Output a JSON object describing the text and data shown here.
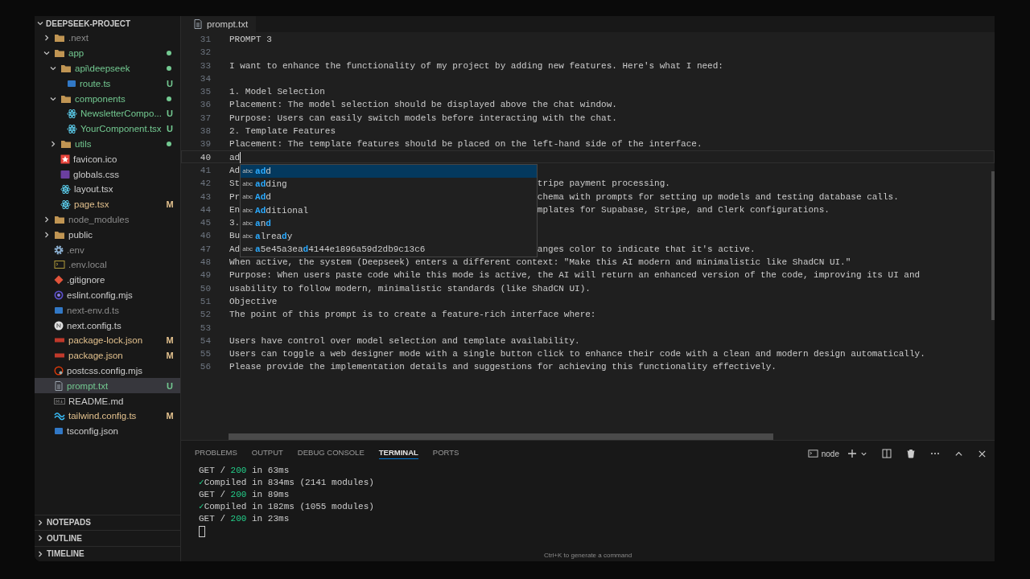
{
  "sidebar": {
    "title": "DEEPSEEK-PROJECT",
    "tree": [
      {
        "name": ".next",
        "kind": "folder",
        "color": "#8b8b8b",
        "expanded": false,
        "selected": false
      },
      {
        "name": "app",
        "kind": "folder",
        "color": "#73c991",
        "dot": true,
        "expanded": true,
        "selected": false,
        "children": [
          {
            "name": "api\\deepseek",
            "kind": "folder",
            "color": "#73c991",
            "dot": true,
            "expanded": true,
            "selected": false,
            "children": [
              {
                "name": "route.ts",
                "kind": "ts",
                "color": "#73c991",
                "badge": "U",
                "selected": false
              }
            ]
          },
          {
            "name": "components",
            "kind": "folder",
            "color": "#73c991",
            "dot": true,
            "expanded": true,
            "selected": false,
            "children": [
              {
                "name": "NewsletterCompo...",
                "kind": "react",
                "color": "#73c991",
                "badge": "U",
                "selected": false
              },
              {
                "name": "YourComponent.tsx",
                "kind": "react",
                "color": "#73c991",
                "badge": "U",
                "selected": false
              }
            ]
          },
          {
            "name": "utils",
            "kind": "folder",
            "color": "#73c991",
            "dot": true,
            "expanded": false,
            "selected": false
          },
          {
            "name": "favicon.ico",
            "kind": "favicon",
            "color": "#cccccc",
            "selected": false
          },
          {
            "name": "globals.css",
            "kind": "css",
            "color": "#cccccc",
            "selected": false
          },
          {
            "name": "layout.tsx",
            "kind": "react",
            "color": "#cccccc",
            "selected": false
          },
          {
            "name": "page.tsx",
            "kind": "react",
            "color": "#e2c08d",
            "badge": "M",
            "selected": false
          }
        ]
      },
      {
        "name": "node_modules",
        "kind": "folder",
        "color": "#8b8b8b",
        "expanded": false,
        "selected": false
      },
      {
        "name": "public",
        "kind": "folder",
        "color": "#cccccc",
        "expanded": false,
        "selected": false
      },
      {
        "name": ".env",
        "kind": "settings",
        "color": "#8b8b8b",
        "selected": false
      },
      {
        "name": ".env.local",
        "kind": "terminal",
        "color": "#8b8b8b",
        "selected": false
      },
      {
        "name": ".gitignore",
        "kind": "git",
        "color": "#cccccc",
        "selected": false
      },
      {
        "name": "eslint.config.mjs",
        "kind": "eslint",
        "color": "#cccccc",
        "selected": false
      },
      {
        "name": "next-env.d.ts",
        "kind": "ts",
        "color": "#8b8b8b",
        "selected": false
      },
      {
        "name": "next.config.ts",
        "kind": "next",
        "color": "#cccccc",
        "selected": false
      },
      {
        "name": "package-lock.json",
        "kind": "json",
        "color": "#e2c08d",
        "badge": "M",
        "selected": false
      },
      {
        "name": "package.json",
        "kind": "json",
        "color": "#e2c08d",
        "badge": "M",
        "selected": false
      },
      {
        "name": "postcss.config.mjs",
        "kind": "postcss",
        "color": "#cccccc",
        "selected": false
      },
      {
        "name": "prompt.txt",
        "kind": "text",
        "color": "#73c991",
        "badge": "U",
        "selected": true
      },
      {
        "name": "README.md",
        "kind": "markdown",
        "color": "#cccccc",
        "selected": false
      },
      {
        "name": "tailwind.config.ts",
        "kind": "tailwind",
        "color": "#e2c08d",
        "badge": "M",
        "selected": false
      },
      {
        "name": "tsconfig.json",
        "kind": "ts",
        "color": "#cccccc",
        "selected": false
      }
    ],
    "sections": [
      {
        "label": "NOTEPADS",
        "expanded": false
      },
      {
        "label": "OUTLINE",
        "expanded": false
      },
      {
        "label": "TIMELINE",
        "expanded": false
      }
    ]
  },
  "editor": {
    "tab": {
      "label": "prompt.txt",
      "selected": true
    },
    "lines": [
      {
        "number": "31",
        "text": "PROMPT 3",
        "current": false
      },
      {
        "number": "32",
        "current": false
      },
      {
        "number": "33",
        "text": "I want to enhance the functionality of my project by adding new features. Here's what I need:",
        "current": false
      },
      {
        "number": "34",
        "current": false
      },
      {
        "number": "35",
        "text": "1. Model Selection",
        "current": false
      },
      {
        "number": "36",
        "text": "Placement: The model selection should be displayed above the chat window.",
        "current": false
      },
      {
        "number": "37",
        "text": "Purpose: Users can easily switch models before interacting with the chat.",
        "current": false
      },
      {
        "number": "38",
        "text": "2. Template Features",
        "current": false
      },
      {
        "number": "39",
        "text": "Placement: The template features should be placed on the left-hand side of the interface.",
        "current": false
      },
      {
        "number": "40",
        "text": "ad",
        "current": true
      },
      {
        "number": "41",
        "text": "Ad",
        "current": false
      },
      {
        "number": "42",
        "text": "St",
        "tail": "tripe payment processing.",
        "current": false
      },
      {
        "number": "43",
        "text": "Pr",
        "tail": "chema with prompts for setting up models and testing database calls.",
        "current": false
      },
      {
        "number": "44",
        "text": "En",
        "tail": "mplates for Supabase, Stripe, and Clerk configurations.",
        "current": false
      },
      {
        "number": "45",
        "text": "3.",
        "current": false
      },
      {
        "number": "46",
        "text": "Bu",
        "current": false
      },
      {
        "number": "47",
        "text": "Ad",
        "tail": "anges color to indicate that it's active.",
        "current": false
      },
      {
        "number": "48",
        "text": "When active, the system (Deepseek) enters a different context: \"Make this AI modern and minimalistic like ShadCN UI.\"",
        "current": false
      },
      {
        "number": "49",
        "text": "Purpose: When users paste code while this mode is active, the AI will return an enhanced version of the code, improving its UI and",
        "current": false
      },
      {
        "number": "50",
        "text": "usability to follow modern, minimalistic standards (like ShadCN UI).",
        "current": false
      },
      {
        "number": "51",
        "text": "Objective",
        "current": false
      },
      {
        "number": "52",
        "text": "The point of this prompt is to create a feature-rich interface where:",
        "current": false
      },
      {
        "number": "53",
        "current": false
      },
      {
        "number": "54",
        "text": "Users have control over model selection and template availability.",
        "current": false
      },
      {
        "number": "55",
        "text": "Users can toggle a web designer mode with a single button click to enhance their code with a clean and modern design automatically.",
        "current": false
      },
      {
        "number": "56",
        "text": "Please provide the implementation details and suggestions for achieving this functionality effectively.",
        "current": false
      }
    ],
    "suggestions": [
      {
        "symbol": "abc",
        "selected": true,
        "parts": [
          {
            "text": "ad",
            "match": true
          },
          {
            "text": "d",
            "match": false
          }
        ]
      },
      {
        "symbol": "abc",
        "selected": false,
        "parts": [
          {
            "text": "ad",
            "match": true
          },
          {
            "text": "ding",
            "match": false
          }
        ]
      },
      {
        "symbol": "abc",
        "selected": false,
        "parts": [
          {
            "text": "Ad",
            "match": true
          },
          {
            "text": "d",
            "match": false
          }
        ]
      },
      {
        "symbol": "abc",
        "selected": false,
        "parts": [
          {
            "text": "Ad",
            "match": true
          },
          {
            "text": "ditional",
            "match": false
          }
        ]
      },
      {
        "symbol": "abc",
        "selected": false,
        "parts": [
          {
            "text": "a",
            "match": true
          },
          {
            "text": "n",
            "match": false
          },
          {
            "text": "d",
            "match": true
          }
        ]
      },
      {
        "symbol": "abc",
        "selected": false,
        "parts": [
          {
            "text": "a",
            "match": true
          },
          {
            "text": "lrea",
            "match": false
          },
          {
            "text": "d",
            "match": true
          },
          {
            "text": "y",
            "match": false
          }
        ]
      },
      {
        "symbol": "abc",
        "selected": false,
        "parts": [
          {
            "text": "a",
            "match": true
          },
          {
            "text": "5e45a3ea",
            "match": false
          },
          {
            "text": "d",
            "match": true
          },
          {
            "text": "4144e1896a59d2db9c13c6",
            "match": false
          }
        ]
      }
    ]
  },
  "panel": {
    "tabs": [
      {
        "label": "PROBLEMS",
        "selected": false
      },
      {
        "label": "OUTPUT",
        "selected": false
      },
      {
        "label": "DEBUG CONSOLE",
        "selected": false
      },
      {
        "label": "TERMINAL",
        "selected": true
      },
      {
        "label": "PORTS",
        "selected": false
      }
    ],
    "terminal": {
      "name": "node",
      "lines": [
        {
          "kind": "request",
          "method": "GET /",
          "status": "200",
          "time": "in 63ms"
        },
        {
          "kind": "compiled",
          "mark": "✓",
          "text": "Compiled in 834ms (2141 modules)"
        },
        {
          "kind": "request",
          "method": "GET /",
          "status": "200",
          "time": "in 89ms"
        },
        {
          "kind": "compiled",
          "mark": "✓",
          "text": "Compiled in 182ms (1055 modules)"
        },
        {
          "kind": "request",
          "method": "GET /",
          "status": "200",
          "time": "in 23ms"
        }
      ]
    },
    "hint": "Ctrl+K to generate a command"
  }
}
